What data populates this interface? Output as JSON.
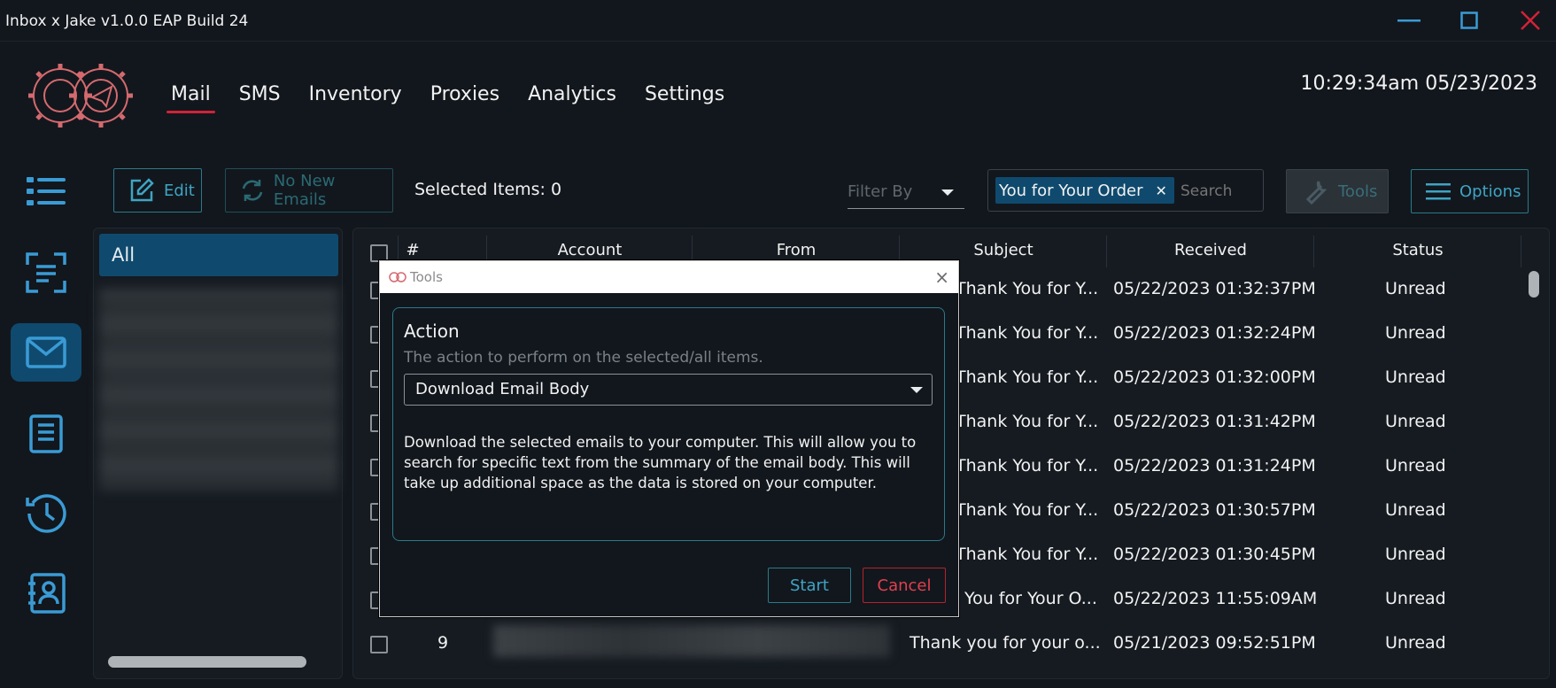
{
  "window": {
    "title": "Inbox x Jake v1.0.0 EAP Build 24",
    "colors": {
      "accent": "#3ea4c4",
      "active_bg": "#0f4a6e",
      "danger": "#d32236",
      "bg": "#12171d"
    }
  },
  "nav": {
    "items": [
      {
        "label": "Mail",
        "active": true
      },
      {
        "label": "SMS"
      },
      {
        "label": "Inventory"
      },
      {
        "label": "Proxies"
      },
      {
        "label": "Analytics"
      },
      {
        "label": "Settings"
      }
    ]
  },
  "clock": {
    "text": "10:29:34am 05/23/2023"
  },
  "rail": {
    "icons": [
      "list-icon",
      "scan-icon",
      "mail-icon",
      "document-icon",
      "history-icon",
      "contacts-icon"
    ],
    "active": "mail-icon"
  },
  "toolbar": {
    "edit_label": "Edit",
    "no_new_label": "No New Emails",
    "selected_items": "Selected Items: 0",
    "filter_label": "Filter By",
    "chip_label": "You for Your Order",
    "search_placeholder": "Search",
    "tools_label": "Tools",
    "options_label": "Options"
  },
  "folders": {
    "all_label": "All"
  },
  "table": {
    "columns": [
      "#",
      "Account",
      "From",
      "Subject",
      "Received",
      "Status"
    ],
    "rows": [
      {
        "subject": "Thank You for Y...",
        "received": "05/22/2023 01:32:37PM",
        "status": "Unread"
      },
      {
        "subject": "Thank You for Y...",
        "received": "05/22/2023 01:32:24PM",
        "status": "Unread"
      },
      {
        "subject": "Thank You for Y...",
        "received": "05/22/2023 01:32:00PM",
        "status": "Unread"
      },
      {
        "subject": "Thank You for Y...",
        "received": "05/22/2023 01:31:42PM",
        "status": "Unread"
      },
      {
        "subject": "Thank You for Y...",
        "received": "05/22/2023 01:31:24PM",
        "status": "Unread"
      },
      {
        "subject": "Thank You for Y...",
        "received": "05/22/2023 01:30:57PM",
        "status": "Unread"
      },
      {
        "subject": "Thank You for Y...",
        "received": "05/22/2023 01:30:45PM",
        "status": "Unread"
      },
      {
        "subject": "You for Your O...",
        "received": "05/22/2023 11:55:09AM",
        "status": "Unread"
      },
      {
        "num": "9",
        "subject": "Thank you for your o...",
        "received": "05/21/2023 09:52:51PM",
        "status": "Unread"
      }
    ]
  },
  "dialog": {
    "title": "Tools",
    "close": "×",
    "section_title": "Action",
    "section_subtitle": "The action to perform on the selected/all items.",
    "action_value": "Download Email Body",
    "description": "Download the selected emails to your computer. This will allow you to search for specific text from the summary of the email body. This will take up additional space as the data is stored on your computer.",
    "start_label": "Start",
    "cancel_label": "Cancel"
  }
}
